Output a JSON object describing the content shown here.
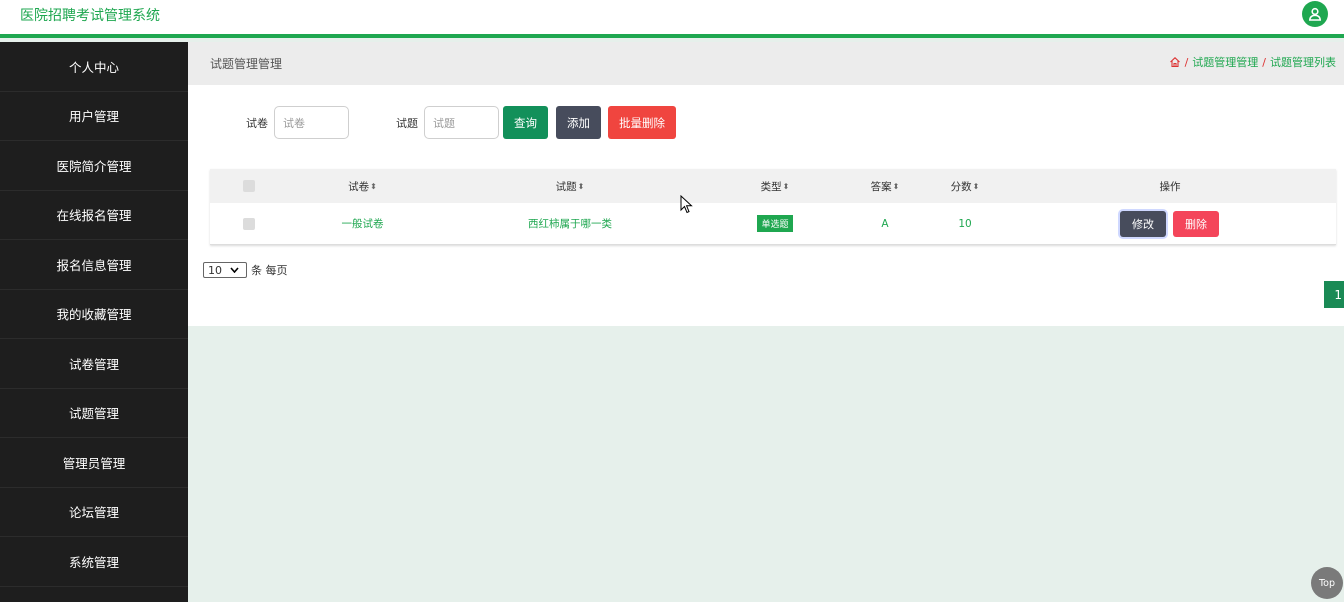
{
  "header": {
    "title": "医院招聘考试管理系统",
    "user_icon": "user-icon",
    "accent": "#1fa750"
  },
  "sidebar": {
    "items": [
      {
        "label": "个人中心"
      },
      {
        "label": "用户管理"
      },
      {
        "label": "医院简介管理"
      },
      {
        "label": "在线报名管理"
      },
      {
        "label": "报名信息管理"
      },
      {
        "label": "我的收藏管理"
      },
      {
        "label": "试卷管理"
      },
      {
        "label": "试题管理"
      },
      {
        "label": "管理员管理"
      },
      {
        "label": "论坛管理"
      },
      {
        "label": "系统管理"
      }
    ]
  },
  "page": {
    "title": "试题管理管理",
    "breadcrumb": [
      "试题管理管理",
      "试题管理列表"
    ]
  },
  "search": {
    "paper_label": "试卷",
    "paper_placeholder": "试卷",
    "question_label": "试题",
    "question_placeholder": "试题",
    "query_button": "查询",
    "add_button": "添加",
    "batch_delete_button": "批量删除"
  },
  "table": {
    "columns": [
      "试卷",
      "试题",
      "类型",
      "答案",
      "分数",
      "操作"
    ],
    "rows": [
      {
        "paper": "一般试卷",
        "question": "西红柿属于哪一类",
        "type": "单选题",
        "answer": "A",
        "score": "10",
        "edit": "修改",
        "delete": "删除"
      }
    ]
  },
  "pagination": {
    "page_size": "10",
    "page_size_suffix": "条 每页",
    "current_page": "1"
  },
  "back_to_top": "Top"
}
